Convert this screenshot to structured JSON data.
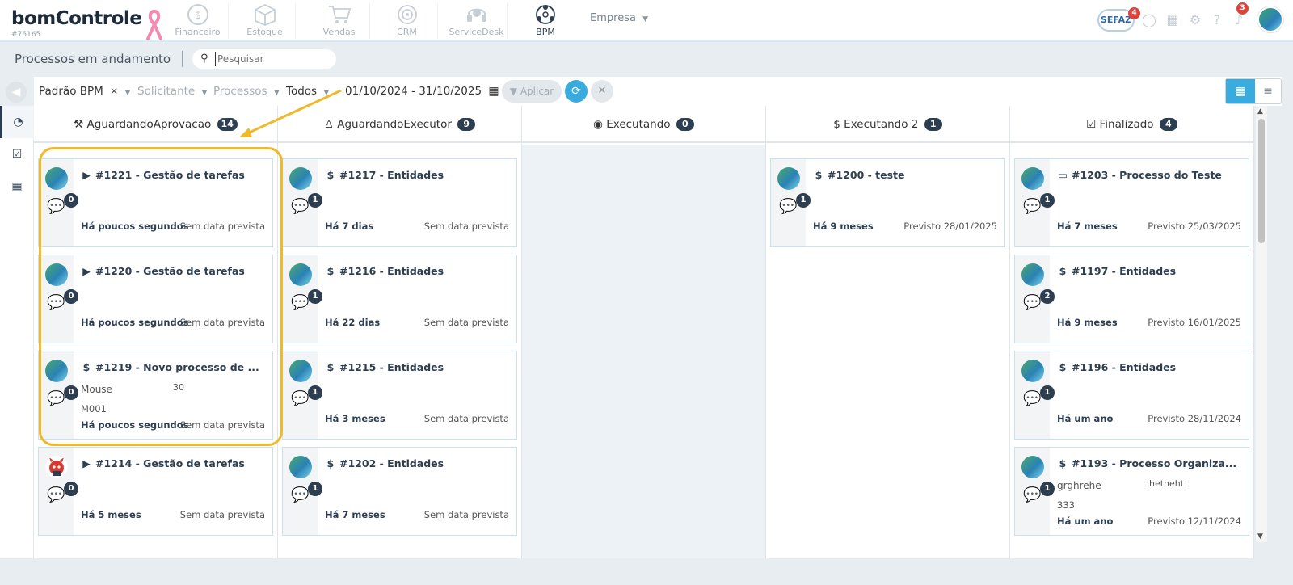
{
  "brand": {
    "logo": "bomControle",
    "id": "#76165"
  },
  "modules": [
    {
      "label": "Financeiro",
      "icon": "dollar-circle-icon"
    },
    {
      "label": "Estoque",
      "icon": "box-icon"
    },
    {
      "label": "Vendas",
      "icon": "cart-icon"
    },
    {
      "label": "CRM",
      "icon": "target-icon"
    },
    {
      "label": "ServiceDesk",
      "icon": "headset-icon"
    },
    {
      "label": "BPM",
      "icon": "network-icon"
    }
  ],
  "empresa": {
    "label": "Empresa"
  },
  "topbar": {
    "sefaz": "SEFAZ",
    "sefaz_badge": "4",
    "notif_badge": "3"
  },
  "page": {
    "title": "Processos em andamento"
  },
  "search": {
    "placeholder": "Pesquisar"
  },
  "filters": {
    "preset": "Padrão BPM",
    "solicitante": "Solicitante",
    "processos": "Processos",
    "todos": "Todos",
    "date_range": "01/10/2024 - 31/10/2025",
    "apply": "Aplicar"
  },
  "columns": [
    {
      "title": "AguardandoAprovacao",
      "count": "14",
      "icon": "gavel-icon"
    },
    {
      "title": "AguardandoExecutor",
      "count": "9",
      "icon": "user-icon"
    },
    {
      "title": "Executando",
      "count": "0",
      "icon": "play-circle-icon"
    },
    {
      "title": "Executando 2",
      "count": "1",
      "icon": "dollar-icon"
    },
    {
      "title": "Finalizado",
      "count": "4",
      "icon": "check-square-icon"
    }
  ],
  "cards": {
    "c0": [
      {
        "title": "#1221 - Gestão de tarefas",
        "comments": "0",
        "ago": "Há poucos segundos",
        "due": "Sem data prevista"
      },
      {
        "title": "#1220 - Gestão de tarefas",
        "comments": "0",
        "ago": "Há poucos segundos",
        "due": "Sem data prevista"
      },
      {
        "title": "#1219 - Novo processo de ...",
        "comments": "0",
        "ago": "Há poucos segundos",
        "due": "Sem data prevista",
        "f1": "Mouse",
        "f2": "30",
        "f3": "M001"
      },
      {
        "title": "#1214 - Gestão de tarefas",
        "comments": "0",
        "ago": "Há 5 meses",
        "due": "Sem data prevista"
      }
    ],
    "c1": [
      {
        "title": "#1217 - Entidades",
        "comments": "1",
        "ago": "Há 7 dias",
        "due": "Sem data prevista"
      },
      {
        "title": "#1216 - Entidades",
        "comments": "1",
        "ago": "Há 22 dias",
        "due": "Sem data prevista"
      },
      {
        "title": "#1215 - Entidades",
        "comments": "1",
        "ago": "Há 3 meses",
        "due": "Sem data prevista"
      },
      {
        "title": "#1202 - Entidades",
        "comments": "1",
        "ago": "Há 7 meses",
        "due": "Sem data prevista"
      }
    ],
    "c3": [
      {
        "title": "#1200 - teste",
        "comments": "1",
        "ago": "Há 9 meses",
        "due": "Previsto 28/01/2025"
      }
    ],
    "c4": [
      {
        "title": "#1203 - Processo do Teste",
        "comments": "1",
        "ago": "Há 7 meses",
        "due": "Previsto 25/03/2025"
      },
      {
        "title": "#1197 - Entidades",
        "comments": "2",
        "ago": "Há 9 meses",
        "due": "Previsto 16/01/2025"
      },
      {
        "title": "#1196 - Entidades",
        "comments": "1",
        "ago": "Há um ano",
        "due": "Previsto 28/11/2024"
      },
      {
        "title": "#1193 - Processo Organiza...",
        "comments": "1",
        "ago": "Há um ano",
        "due": "Previsto 12/11/2024",
        "f1": "grghrehe",
        "f2": "hetheht",
        "f3": "333"
      }
    ]
  }
}
